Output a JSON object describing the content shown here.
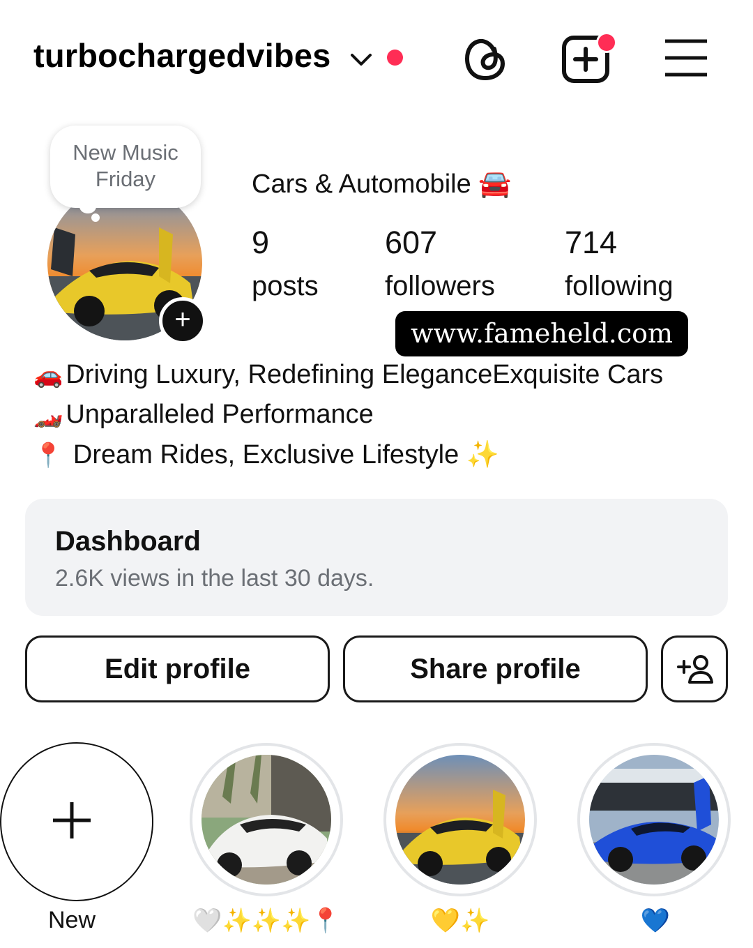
{
  "header": {
    "username": "turbochargedvibes",
    "notification_dot_color": "#ff2d55",
    "icons": [
      "chevron-down-icon",
      "threads-icon",
      "new-post-icon",
      "menu-icon"
    ]
  },
  "note": {
    "line1": "New Music",
    "line2": "Friday"
  },
  "profile": {
    "category": "Cars & Automobile 🚘",
    "stats": {
      "posts": {
        "value": "9",
        "label": "posts"
      },
      "followers": {
        "value": "607",
        "label": "followers"
      },
      "following": {
        "value": "714",
        "label": "following"
      }
    },
    "avatar_add": "+"
  },
  "watermark": "www.fameheld.com",
  "bio": {
    "line1_emoji": "🚗",
    "line1": "Driving Luxury, Redefining EleganceExquisite Cars",
    "line2_emoji": "🏎️",
    "line2": "Unparalleled Performance",
    "line3_emoji": "📍",
    "line3": " Dream Rides, Exclusive Lifestyle ✨"
  },
  "dashboard": {
    "title": "Dashboard",
    "subtitle": "2.6K views in the last 30 days."
  },
  "buttons": {
    "edit": "Edit profile",
    "share": "Share profile",
    "add_person_icon": "add-person-icon"
  },
  "highlights": [
    {
      "label": "New"
    },
    {
      "label": "🤍✨✨✨📍"
    },
    {
      "label": "💛✨"
    },
    {
      "label": "💙"
    }
  ]
}
